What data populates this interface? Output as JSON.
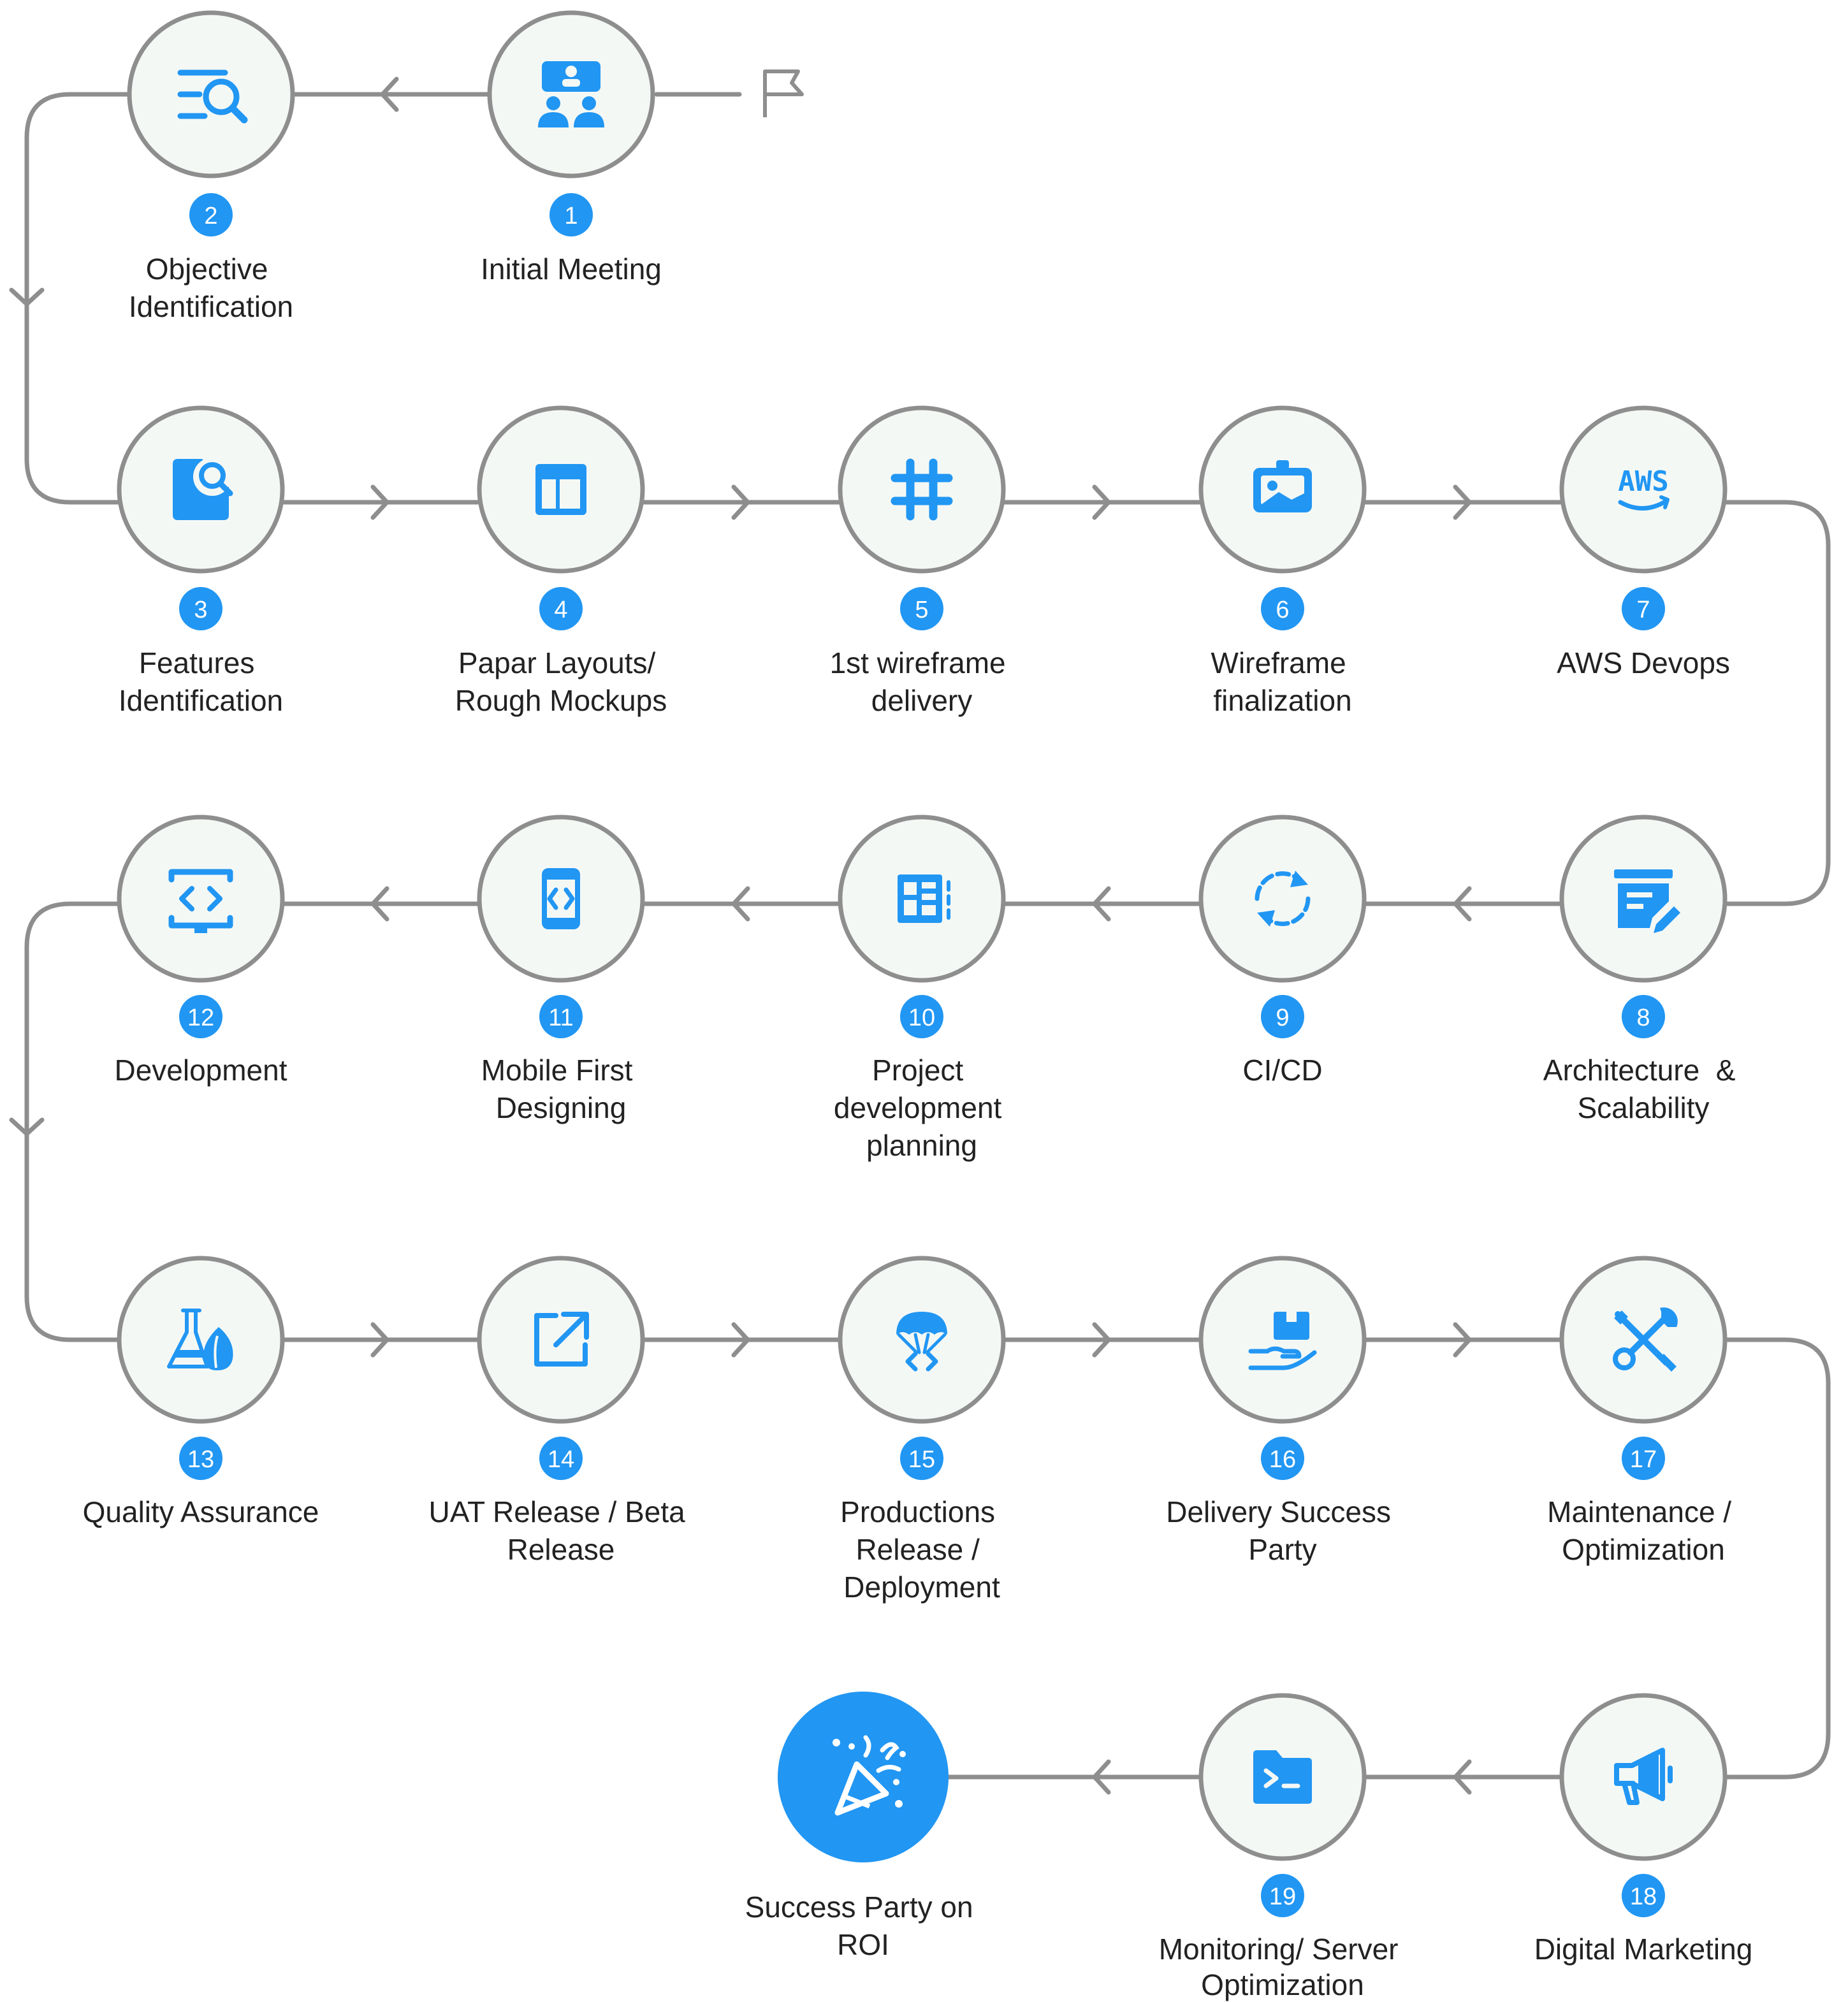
{
  "steps": [
    {
      "number": "1",
      "label": [
        "Initial Meeting"
      ],
      "icon": "presentation-icon"
    },
    {
      "number": "2",
      "label": [
        "Objective",
        "Identification"
      ],
      "icon": "search-list-icon"
    },
    {
      "number": "3",
      "label": [
        "Features",
        "Identification"
      ],
      "icon": "document-search-icon"
    },
    {
      "number": "4",
      "label": [
        "Papar Layouts/",
        "Rough Mockups"
      ],
      "icon": "layout-icon"
    },
    {
      "number": "5",
      "label": [
        "1st wireframe",
        "delivery"
      ],
      "icon": "hashtag-icon"
    },
    {
      "number": "6",
      "label": [
        "Wireframe",
        "finalization"
      ],
      "icon": "image-ticket-icon"
    },
    {
      "number": "7",
      "label": [
        "AWS Devops"
      ],
      "icon": "aws-icon"
    },
    {
      "number": "8",
      "label": [
        "Architecture  &",
        "Scalability"
      ],
      "icon": "edit-box-icon"
    },
    {
      "number": "9",
      "label": [
        "CI/CD"
      ],
      "icon": "sync-icon"
    },
    {
      "number": "10",
      "label": [
        "Project",
        "development",
        "planning"
      ],
      "icon": "dashboard-plan-icon"
    },
    {
      "number": "11",
      "label": [
        "Mobile First",
        "Designing"
      ],
      "icon": "mobile-code-icon"
    },
    {
      "number": "12",
      "label": [
        "Development"
      ],
      "icon": "monitor-code-icon"
    },
    {
      "number": "13",
      "label": [
        "Quality Assurance"
      ],
      "icon": "flask-icon"
    },
    {
      "number": "14",
      "label": [
        "UAT Release / Beta",
        "Release"
      ],
      "icon": "external-link-icon"
    },
    {
      "number": "15",
      "label": [
        "Productions",
        "Release /",
        "Deployment"
      ],
      "icon": "parachute-code-icon"
    },
    {
      "number": "16",
      "label": [
        "Delivery Success",
        "Party"
      ],
      "icon": "hand-package-icon"
    },
    {
      "number": "17",
      "label": [
        "Maintenance /",
        "Optimization"
      ],
      "icon": "tools-icon"
    },
    {
      "number": "18",
      "label": [
        "Digital Marketing"
      ],
      "icon": "megaphone-icon"
    },
    {
      "number": "19",
      "label": [
        "Monitoring/ Server",
        "Optimization"
      ],
      "icon": "terminal-folder-icon"
    },
    {
      "number": "",
      "label": [
        "Success Party on",
        "ROI"
      ],
      "icon": "party-popper-icon"
    }
  ],
  "start_marker": {
    "icon": "flag-icon"
  },
  "colors": {
    "accent": "#2196f3",
    "line": "#8e8e8e",
    "node_fill": "#f4f8f5",
    "text": "#222222"
  }
}
